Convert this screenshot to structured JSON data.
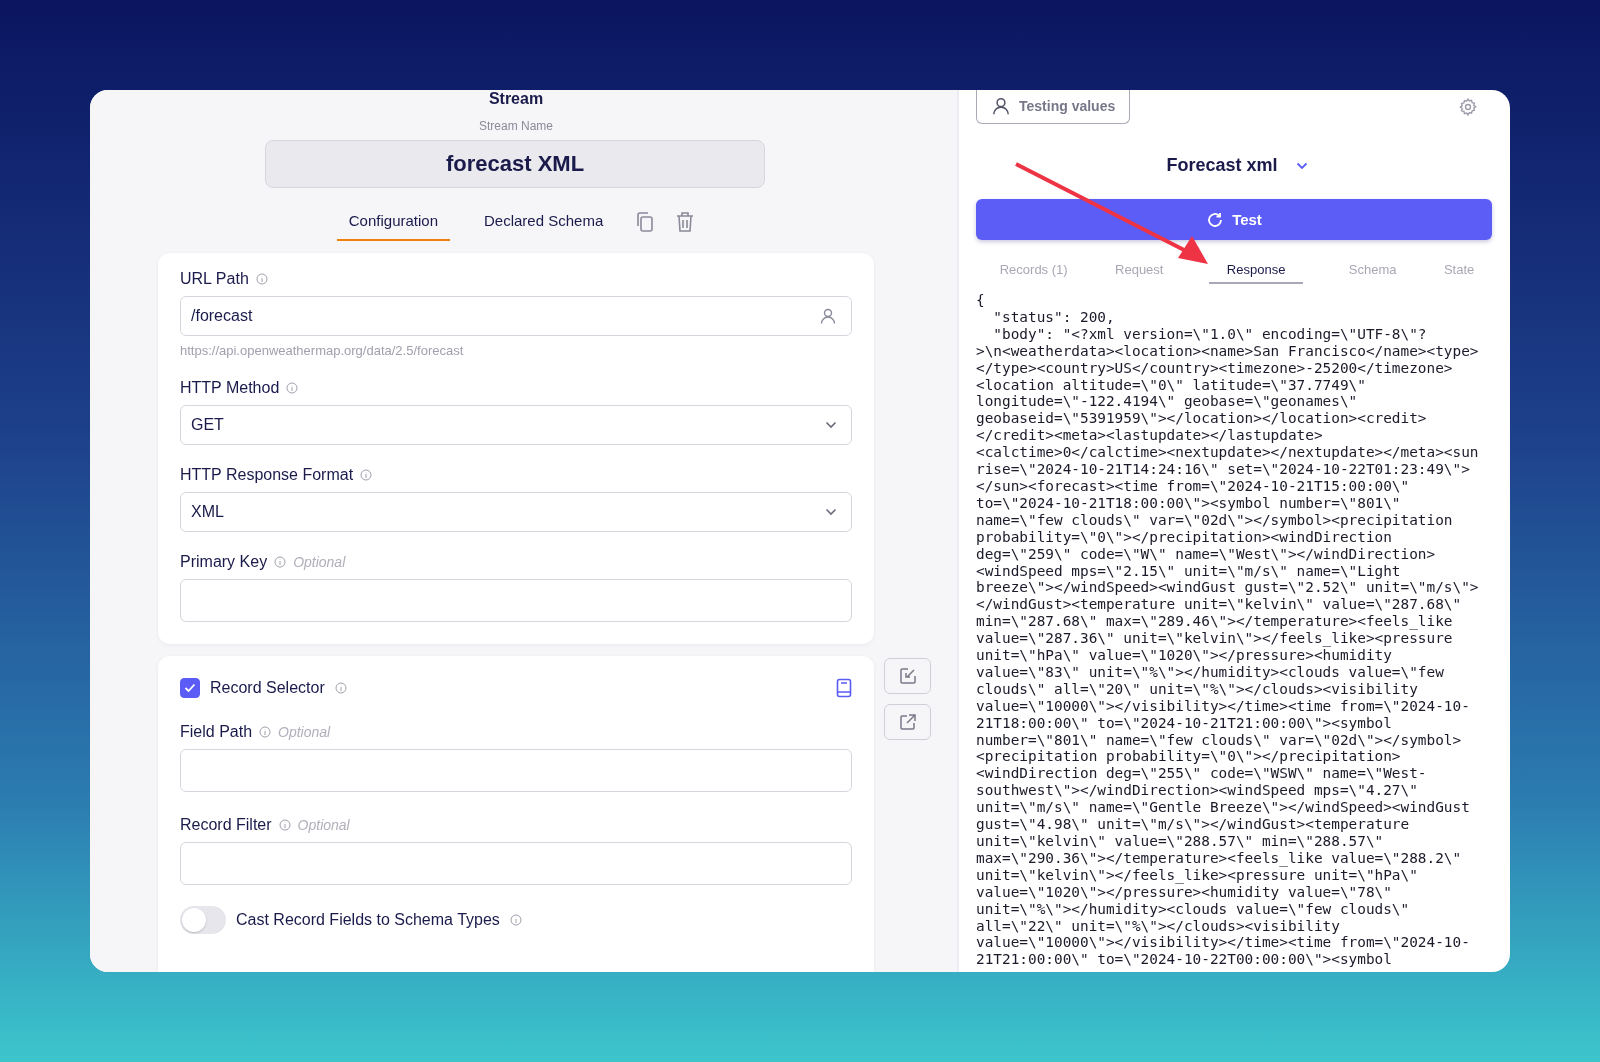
{
  "stream": {
    "heading": "Stream",
    "name_label": "Stream Name",
    "name": "forecast XML"
  },
  "tabs": [
    {
      "label": "Configuration",
      "selected": true
    },
    {
      "label": "Declared Schema",
      "selected": false
    }
  ],
  "config_fields": [
    {
      "kind": "text",
      "label": "URL Path",
      "value": "/forecast",
      "hint": "https://api.openweathermap.org/data/2.5/forecast"
    },
    {
      "kind": "select",
      "label": "HTTP Method",
      "value": "GET"
    },
    {
      "kind": "select",
      "label": "HTTP Response Format",
      "value": "XML"
    },
    {
      "kind": "empty",
      "label": "Primary Key",
      "optional": "Optional"
    }
  ],
  "record_selector": {
    "label": "Record Selector",
    "checked": true,
    "fields": [
      {
        "kind": "empty",
        "label": "Field Path",
        "optional": "Optional"
      },
      {
        "kind": "empty",
        "label": "Record Filter",
        "optional": "Optional"
      }
    ],
    "cast_toggle": {
      "label": "Cast Record Fields to Schema Types",
      "on": false
    }
  },
  "testing": {
    "testing_values": "Testing values",
    "stream_selector": "Forecast xml",
    "test_button": "Test",
    "tabs": [
      {
        "label": "Records (1)",
        "selected": false
      },
      {
        "label": "Request",
        "selected": false
      },
      {
        "label": "Response",
        "selected": true
      },
      {
        "label": "Schema",
        "selected": false
      },
      {
        "label": "State",
        "selected": false
      }
    ],
    "response_lines": [
      "{",
      "  \"status\": 200,",
      "  \"body\": \"<?xml version=\\\"1.0\\\" encoding=\\\"UTF-8\\\"?",
      ">\\n<weatherdata><location><name>San Francisco</name><type>",
      "</type><country>US</country><timezone>-25200</timezone>",
      "<location altitude=\\\"0\\\" latitude=\\\"37.7749\\\"",
      "longitude=\\\"-122.4194\\\" geobase=\\\"geonames\\\"",
      "geobaseid=\\\"5391959\\\"></location></location><credit>",
      "</credit><meta><lastupdate></lastupdate>",
      "<calctime>0</calctime><nextupdate></nextupdate></meta><sun",
      "rise=\\\"2024-10-21T14:24:16\\\" set=\\\"2024-10-22T01:23:49\\\">",
      "</sun><forecast><time from=\\\"2024-10-21T15:00:00\\\"",
      "to=\\\"2024-10-21T18:00:00\\\"><symbol number=\\\"801\\\"",
      "name=\\\"few clouds\\\" var=\\\"02d\\\"></symbol><precipitation",
      "probability=\\\"0\\\"></precipitation><windDirection",
      "deg=\\\"259\\\" code=\\\"W\\\" name=\\\"West\\\"></windDirection>",
      "<windSpeed mps=\\\"2.15\\\" unit=\\\"m/s\\\" name=\\\"Light",
      "breeze\\\"></windSpeed><windGust gust=\\\"2.52\\\" unit=\\\"m/s\\\">",
      "</windGust><temperature unit=\\\"kelvin\\\" value=\\\"287.68\\\"",
      "min=\\\"287.68\\\" max=\\\"289.46\\\"></temperature><feels_like",
      "value=\\\"287.36\\\" unit=\\\"kelvin\\\"></feels_like><pressure",
      "unit=\\\"hPa\\\" value=\\\"1020\\\"></pressure><humidity",
      "value=\\\"83\\\" unit=\\\"%\\\"></humidity><clouds value=\\\"few",
      "clouds\\\" all=\\\"20\\\" unit=\\\"%\\\"></clouds><visibility",
      "value=\\\"10000\\\"></visibility></time><time from=\\\"2024-10-",
      "21T18:00:00\\\" to=\\\"2024-10-21T21:00:00\\\"><symbol",
      "number=\\\"801\\\" name=\\\"few clouds\\\" var=\\\"02d\\\"></symbol>",
      "<precipitation probability=\\\"0\\\"></precipitation>",
      "<windDirection deg=\\\"255\\\" code=\\\"WSW\\\" name=\\\"West-",
      "southwest\\\"></windDirection><windSpeed mps=\\\"4.27\\\"",
      "unit=\\\"m/s\\\" name=\\\"Gentle Breeze\\\"></windSpeed><windGust",
      "gust=\\\"4.98\\\" unit=\\\"m/s\\\"></windGust><temperature",
      "unit=\\\"kelvin\\\" value=\\\"288.57\\\" min=\\\"288.57\\\"",
      "max=\\\"290.36\\\"></temperature><feels_like value=\\\"288.2\\\"",
      "unit=\\\"kelvin\\\"></feels_like><pressure unit=\\\"hPa\\\"",
      "value=\\\"1020\\\"></pressure><humidity value=\\\"78\\\"",
      "unit=\\\"%\\\"></humidity><clouds value=\\\"few clouds\\\"",
      "all=\\\"22\\\" unit=\\\"%\\\"></clouds><visibility",
      "value=\\\"10000\\\"></visibility></time><time from=\\\"2024-10-",
      "21T21:00:00\\\" to=\\\"2024-10-22T00:00:00\\\"><symbol"
    ]
  }
}
